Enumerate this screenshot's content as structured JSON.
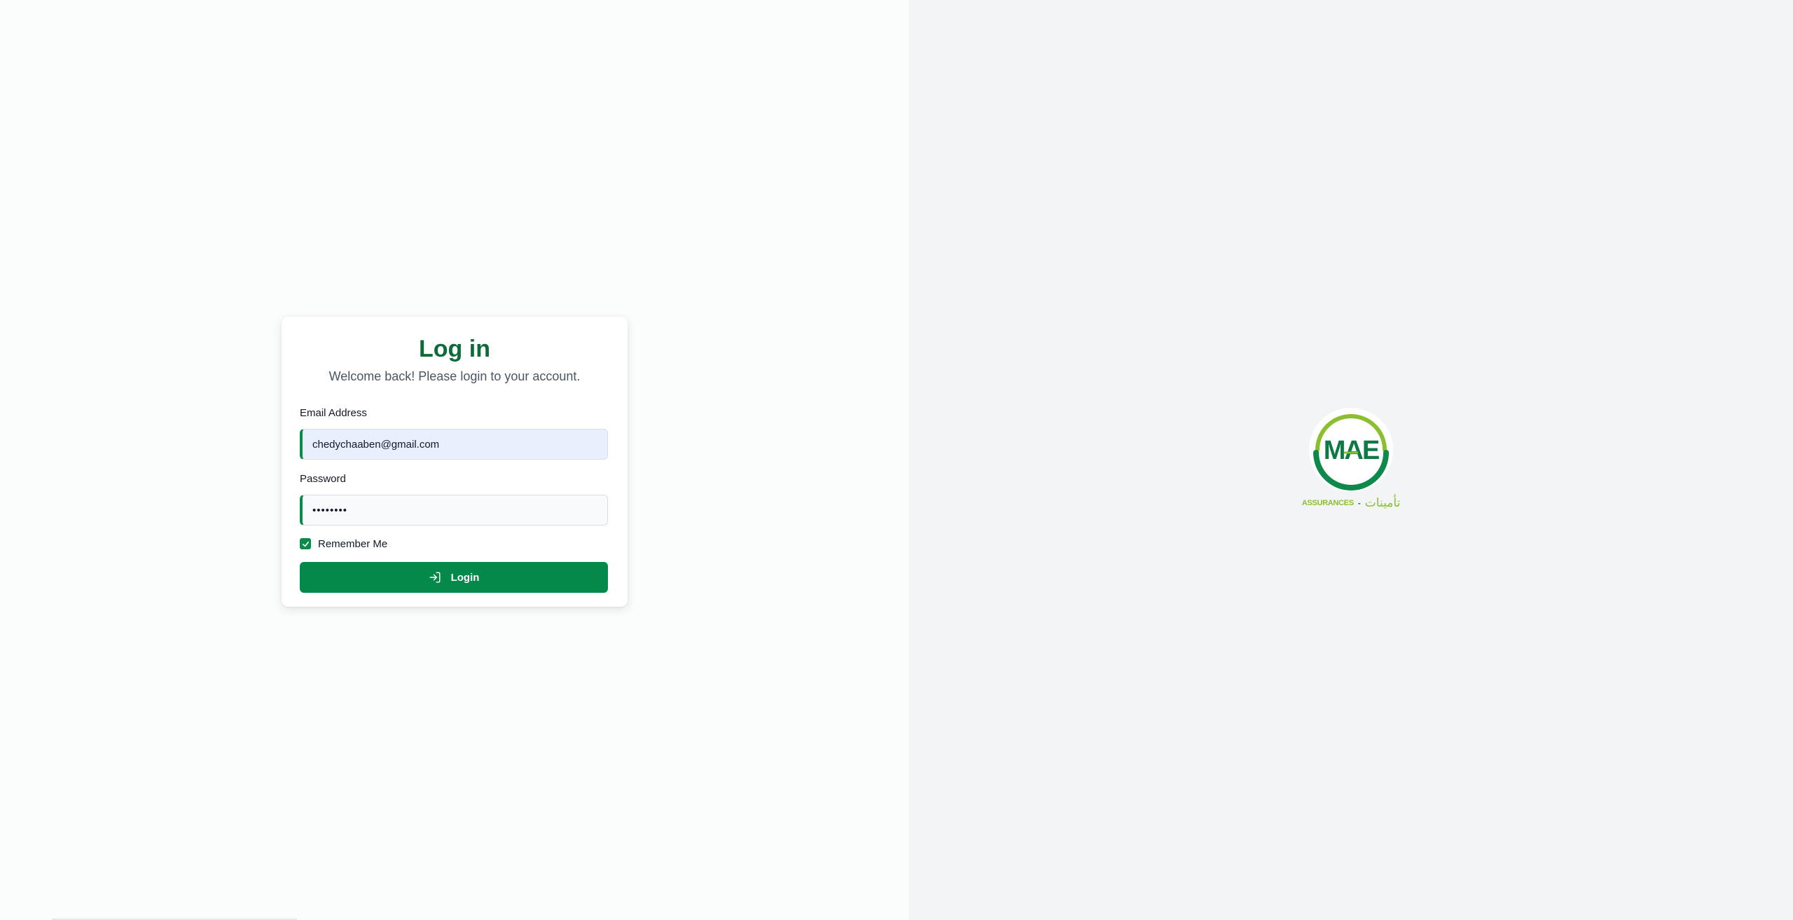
{
  "login": {
    "title": "Log in",
    "subtitle": "Welcome back! Please login to your account.",
    "email_label": "Email Address",
    "email_value": "chedychaaben@gmail.com",
    "password_label": "Password",
    "password_value": "••••••••",
    "remember_label": "Remember Me",
    "remember_checked": true,
    "button_label": "Login",
    "button_icon": "login-arrow-icon"
  },
  "brand": {
    "logo_text": "MAE",
    "tagline_latin": "ASSURANCES",
    "tagline_separator": "-",
    "tagline_arabic": "تأمينات",
    "colors": {
      "primary_green": "#0d8a4b",
      "dark_green": "#0d6b3a",
      "lime": "#8bbf2e"
    }
  }
}
